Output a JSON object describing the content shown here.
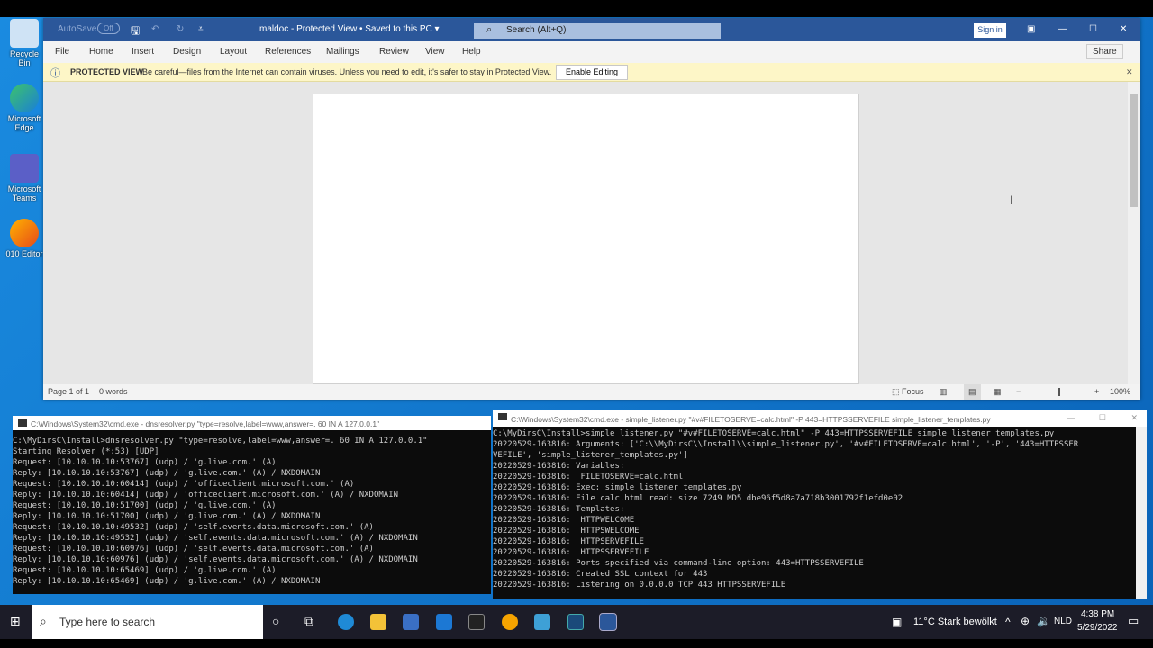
{
  "desktop": {
    "icons": [
      "Recycle Bin",
      "Microsoft Edge",
      "Microsoft Teams",
      "010 Editor"
    ]
  },
  "word": {
    "autosave": "AutoSave",
    "autosave_state": "Off",
    "title": "maldoc  -  Protected View • Saved to this PC ▾",
    "search": "Search (Alt+Q)",
    "sign_in": "Sign in",
    "tabs": [
      "File",
      "Home",
      "Insert",
      "Design",
      "Layout",
      "References",
      "Mailings",
      "Review",
      "View",
      "Help"
    ],
    "share": "Share",
    "protected_label": "PROTECTED VIEW",
    "protected_msg": "Be careful—files from the Internet can contain viruses. Unless you need to edit, it's safer to stay in Protected View.",
    "enable_editing": "Enable Editing",
    "status_page": "Page 1 of 1",
    "status_words": "0 words",
    "focus": "Focus",
    "zoom": "100%",
    "zoom_level": 100
  },
  "cmd_left": {
    "title": "C:\\Windows\\System32\\cmd.exe - dnsresolver.py  \"type=resolve,label=www,answer=. 60 IN A 127.0.0.1\"",
    "lines": [
      "C:\\MyDirsC\\Install>dnsresolver.py \"type=resolve,label=www,answer=. 60 IN A 127.0.0.1\"",
      "Starting Resolver (*:53) [UDP]",
      "Request: [10.10.10.10:53767] (udp) / 'g.live.com.' (A)",
      "Reply: [10.10.10.10:53767] (udp) / 'g.live.com.' (A) / NXDOMAIN",
      "Request: [10.10.10.10:60414] (udp) / 'officeclient.microsoft.com.' (A)",
      "Reply: [10.10.10.10:60414] (udp) / 'officeclient.microsoft.com.' (A) / NXDOMAIN",
      "Request: [10.10.10.10:51700] (udp) / 'g.live.com.' (A)",
      "Reply: [10.10.10.10:51700] (udp) / 'g.live.com.' (A) / NXDOMAIN",
      "Request: [10.10.10.10:49532] (udp) / 'self.events.data.microsoft.com.' (A)",
      "Reply: [10.10.10.10:49532] (udp) / 'self.events.data.microsoft.com.' (A) / NXDOMAIN",
      "Request: [10.10.10.10:60976] (udp) / 'self.events.data.microsoft.com.' (A)",
      "Reply: [10.10.10.10:60976] (udp) / 'self.events.data.microsoft.com.' (A) / NXDOMAIN",
      "Request: [10.10.10.10:65469] (udp) / 'g.live.com.' (A)",
      "Reply: [10.10.10.10:65469] (udp) / 'g.live.com.' (A) / NXDOMAIN"
    ]
  },
  "cmd_right": {
    "title": "C:\\Windows\\System32\\cmd.exe - simple_listener.py  \"#v#FILETOSERVE=calc.html\" -P 443=HTTPSSERVEFILE simple_listener_templates.py",
    "lines": [
      "C:\\MyDirsC\\Install>simple_listener.py \"#v#FILETOSERVE=calc.html\" -P 443=HTTPSSERVEFILE simple_listener_templates.py",
      "20220529-163816: Arguments: ['C:\\\\MyDirsC\\\\Install\\\\simple_listener.py', '#v#FILETOSERVE=calc.html', '-P', '443=HTTPSSER",
      "VEFILE', 'simple_listener_templates.py']",
      "20220529-163816: Variables:",
      "20220529-163816:  FILETOSERVE=calc.html",
      "20220529-163816: Exec: simple_listener_templates.py",
      "20220529-163816: File calc.html read: size 7249 MD5 dbe96f5d8a7a718b3001792f1efd0e02",
      "20220529-163816: Templates:",
      "20220529-163816:  HTTPWELCOME",
      "20220529-163816:  HTTPSWELCOME",
      "20220529-163816:  HTTPSERVEFILE",
      "20220529-163816:  HTTPSSERVEFILE",
      "20220529-163816: Ports specified via command-line option: 443=HTTPSSERVEFILE",
      "20220529-163816: Created SSL context for 443",
      "20220529-163816: Listening on 0.0.0.0 TCP 443 HTTPSSERVEFILE"
    ]
  },
  "taskbar": {
    "search_placeholder": "Type here to search",
    "weather": "11°C  Stark bewölkt",
    "lang": "NLD",
    "time": "4:38 PM",
    "date": "5/29/2022"
  },
  "colors": {
    "word_blue": "#2b579a",
    "protected_bg": "#fdf6c7",
    "taskbar": "#1c1c28"
  }
}
